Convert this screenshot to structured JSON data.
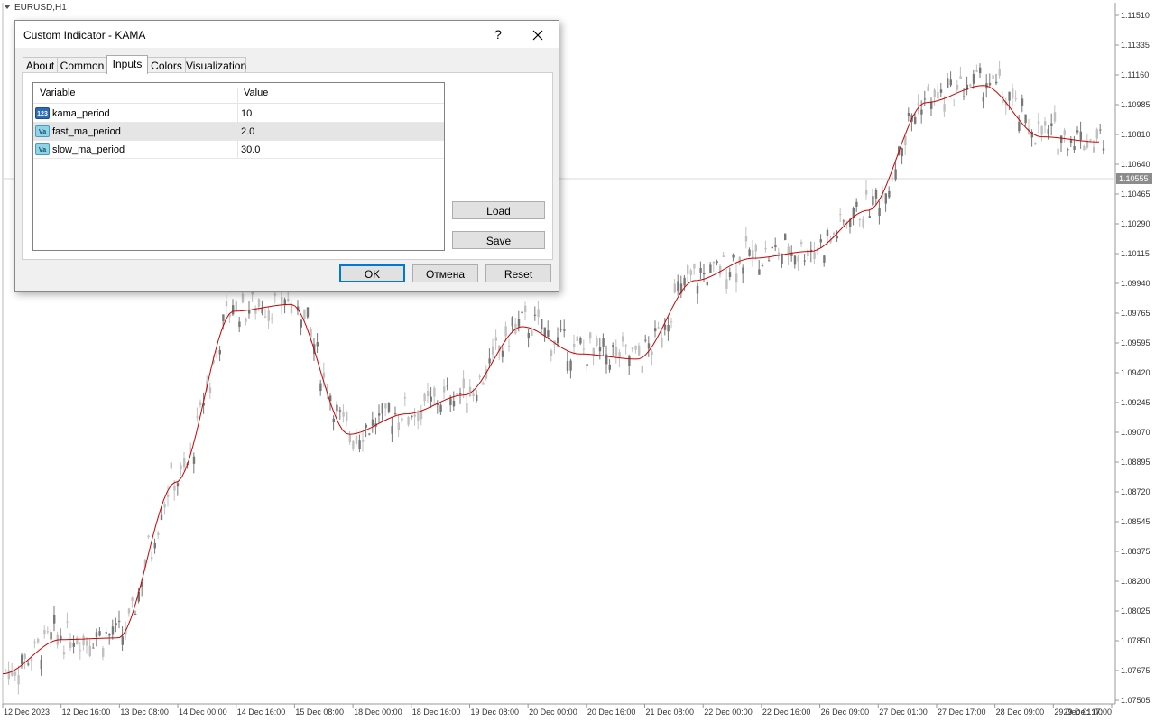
{
  "chart": {
    "symbol": "EURUSD,H1",
    "current_price": "1.10555",
    "price_levels": [
      "1.11510",
      "1.11335",
      "1.11160",
      "1.10985",
      "1.10810",
      "1.10640",
      "1.10465",
      "1.10290",
      "1.10115",
      "1.09940",
      "1.09765",
      "1.09595",
      "1.09420",
      "1.09245",
      "1.09070",
      "1.08895",
      "1.08720",
      "1.08545",
      "1.08375",
      "1.08200",
      "1.08025",
      "1.07850",
      "1.07675",
      "1.07505"
    ],
    "time_labels": [
      "12 Dec 2023",
      "12 Dec 16:00",
      "13 Dec 08:00",
      "14 Dec 00:00",
      "14 Dec 16:00",
      "15 Dec 08:00",
      "18 Dec 00:00",
      "18 Dec 16:00",
      "19 Dec 08:00",
      "20 Dec 00:00",
      "20 Dec 16:00",
      "21 Dec 08:00",
      "22 Dec 00:00",
      "22 Dec 16:00",
      "26 Dec 09:00",
      "27 Dec 01:00",
      "27 Dec 17:00",
      "28 Dec 09:00",
      "29 Dec 01:00",
      "29 Dec 17:00"
    ],
    "colors": {
      "candle": "#777777",
      "candle_light": "#c0c0c0",
      "kama_line": "#cc0000",
      "price_tag": "#8c8c8c"
    }
  },
  "chart_data": {
    "type": "line",
    "title": "",
    "xlabel": "",
    "ylabel": "",
    "ylim": [
      1.07505,
      1.1151
    ],
    "x": [
      "12 Dec 2023",
      "12 Dec 16:00",
      "13 Dec 08:00",
      "14 Dec 00:00",
      "14 Dec 16:00",
      "15 Dec 08:00",
      "18 Dec 00:00",
      "18 Dec 16:00",
      "19 Dec 08:00",
      "20 Dec 00:00",
      "20 Dec 16:00",
      "21 Dec 08:00",
      "22 Dec 00:00",
      "22 Dec 16:00",
      "26 Dec 09:00",
      "27 Dec 01:00",
      "27 Dec 17:00",
      "28 Dec 09:00",
      "29 Dec 01:00",
      "29 Dec 17:00"
    ],
    "series": [
      {
        "values": [
          1.0766,
          1.0786,
          1.0787,
          1.0878,
          1.0978,
          1.0982,
          1.0906,
          1.0918,
          1.0929,
          1.0969,
          1.0953,
          1.095,
          1.0996,
          1.1009,
          1.1013,
          1.1037,
          1.11,
          1.111,
          1.108,
          1.1077
        ]
      }
    ]
  },
  "dialog": {
    "title": "Custom Indicator - KAMA",
    "help": "?",
    "tabs": [
      "About",
      "Common",
      "Inputs",
      "Colors",
      "Visualization"
    ],
    "active_tab": "Inputs",
    "columns": [
      "Variable",
      "Value"
    ],
    "rows": [
      {
        "icon": "123",
        "name": "kama_period",
        "value": "10"
      },
      {
        "icon": "Va",
        "name": "fast_ma_period",
        "value": "2.0"
      },
      {
        "icon": "Va",
        "name": "slow_ma_period",
        "value": "30.0"
      }
    ],
    "load_label": "Load",
    "save_label": "Save",
    "ok_label": "OK",
    "cancel_label": "Отмена",
    "reset_label": "Reset"
  }
}
